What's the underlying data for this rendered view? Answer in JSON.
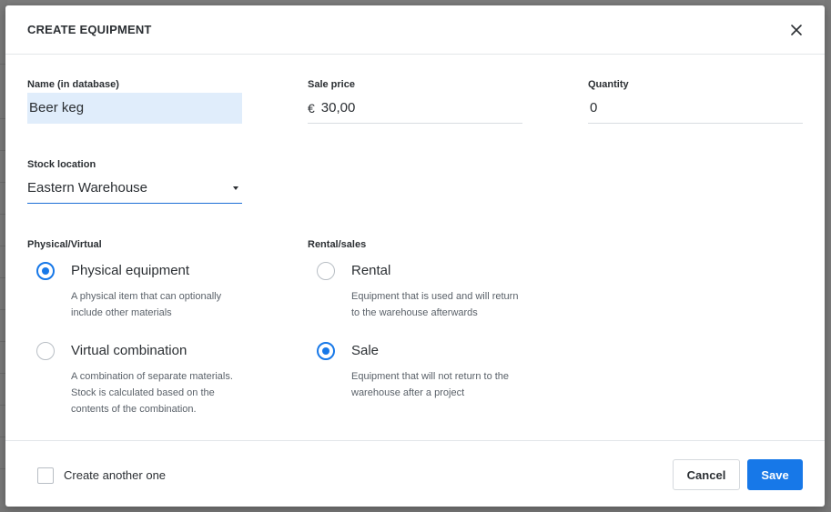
{
  "background": {
    "left_chars": [
      "",
      "",
      "",
      "",
      "",
      "",
      "",
      "",
      "",
      "",
      "",
      "",
      "",
      "",
      "",
      "",
      "",
      "",
      ""
    ]
  },
  "dialog": {
    "title": "CREATE EQUIPMENT",
    "close_icon": "close-icon"
  },
  "fields": {
    "name_label": "Name (in database)",
    "name_value": "Beer keg",
    "sale_price_label": "Sale price",
    "currency_symbol": "€",
    "sale_price_value": "30,00",
    "quantity_label": "Quantity",
    "quantity_value": "0",
    "stock_location_label": "Stock location",
    "stock_location_value": "Eastern Warehouse"
  },
  "physical_virtual": {
    "label": "Physical/Virtual",
    "options": [
      {
        "label": "Physical equipment",
        "description": "A physical item that can optionally include other materials",
        "checked": true
      },
      {
        "label": "Virtual combination",
        "description": "A combination of separate materials. Stock is calculated based on the contents of the combination.",
        "checked": false
      }
    ]
  },
  "rental_sales": {
    "label": "Rental/sales",
    "options": [
      {
        "label": "Rental",
        "description": "Equipment that is used and will return to the warehouse afterwards",
        "checked": false
      },
      {
        "label": "Sale",
        "description": "Equipment that will not return to the warehouse after a project",
        "checked": true
      }
    ]
  },
  "footer": {
    "create_another_label": "Create another one",
    "create_another_checked": false,
    "cancel_label": "Cancel",
    "save_label": "Save"
  },
  "colors": {
    "accent": "#1778e8",
    "name_field_highlight": "#e0edfb",
    "overlay": "#7d7d7d"
  }
}
